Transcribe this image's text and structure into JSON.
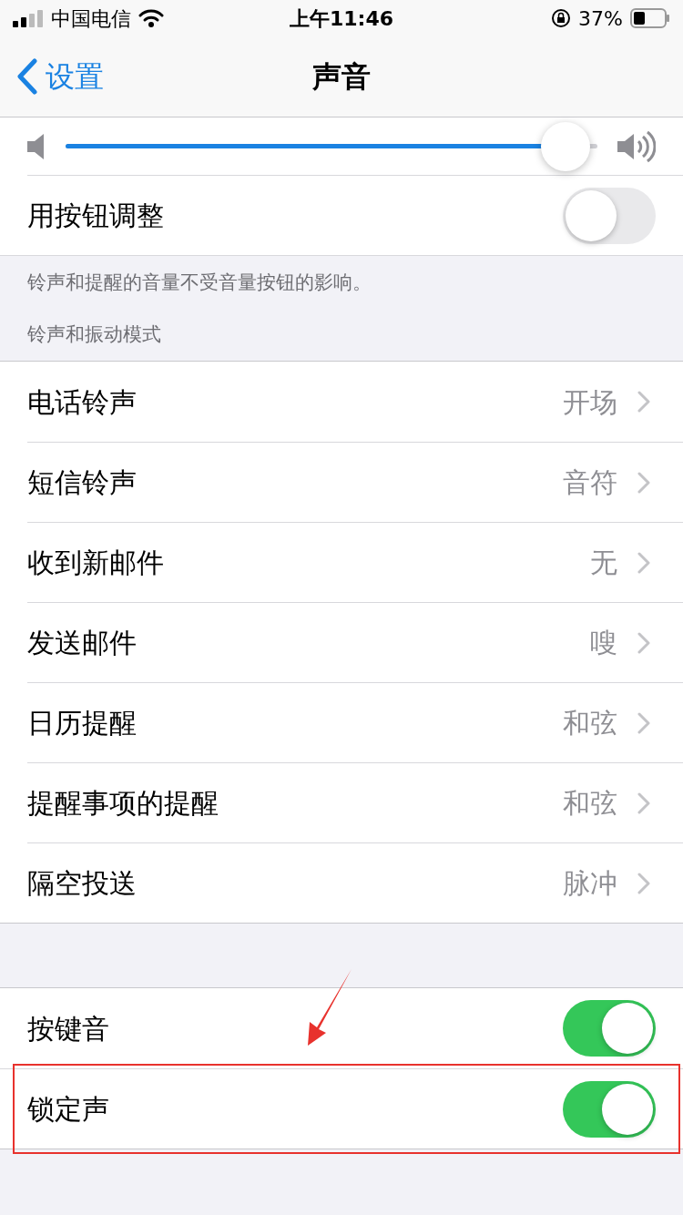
{
  "status_bar": {
    "carrier": "中国电信",
    "time": "上午11:46",
    "battery": "37%"
  },
  "nav": {
    "back": "设置",
    "title": "声音"
  },
  "volume": {
    "level": 0.94
  },
  "button_adjust": {
    "label": "用按钮调整",
    "on": false
  },
  "note": "铃声和提醒的音量不受音量按钮的影响。",
  "section_header": "铃声和振动模式",
  "sounds": [
    {
      "label": "电话铃声",
      "value": "开场"
    },
    {
      "label": "短信铃声",
      "value": "音符"
    },
    {
      "label": "收到新邮件",
      "value": "无"
    },
    {
      "label": "发送邮件",
      "value": "嗖"
    },
    {
      "label": "日历提醒",
      "value": "和弦"
    },
    {
      "label": "提醒事项的提醒",
      "value": "和弦"
    },
    {
      "label": "隔空投送",
      "value": "脉冲"
    }
  ],
  "toggles": [
    {
      "label": "按键音",
      "on": true,
      "highlighted": false
    },
    {
      "label": "锁定声",
      "on": true,
      "highlighted": true
    }
  ]
}
